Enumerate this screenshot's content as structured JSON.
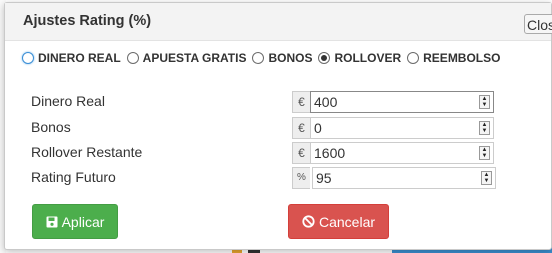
{
  "dialog": {
    "title": "Ajustes Rating (%)",
    "close_label": "Close"
  },
  "radios": [
    {
      "label": "DINERO REAL",
      "checked": false
    },
    {
      "label": "APUESTA GRATIS",
      "checked": false
    },
    {
      "label": "BONOS",
      "checked": false
    },
    {
      "label": "ROLLOVER",
      "checked": true
    },
    {
      "label": "REEMBOLSO",
      "checked": false
    }
  ],
  "fields": [
    {
      "label": "Dinero Real",
      "addon": "€",
      "value": "400"
    },
    {
      "label": "Bonos",
      "addon": "€",
      "value": "0"
    },
    {
      "label": "Rollover Restante",
      "addon": "€",
      "value": "1600"
    },
    {
      "label": "Rating Futuro",
      "addon": "%",
      "value": "95"
    }
  ],
  "buttons": {
    "apply_label": "Aplicar",
    "cancel_label": "Cancelar"
  },
  "colors": {
    "apply": "#5cb85c",
    "cancel": "#d9534f"
  }
}
